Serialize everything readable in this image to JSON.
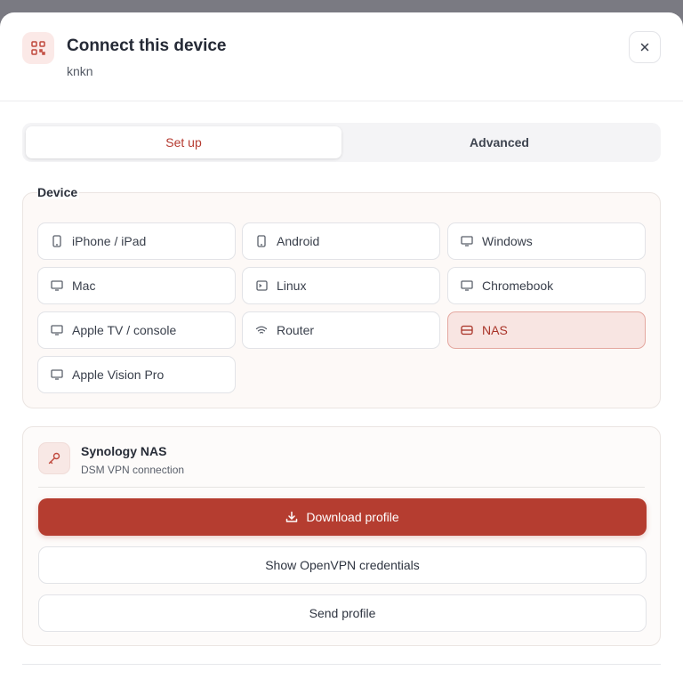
{
  "dialog": {
    "title": "Connect this device",
    "subtitle": "knkn",
    "header_icon": "qr-code-icon",
    "close_icon": "close-icon"
  },
  "tabs": [
    {
      "label": "Set up",
      "active": true
    },
    {
      "label": "Advanced",
      "active": false
    }
  ],
  "device": {
    "legend": "Device",
    "options": [
      {
        "label": "iPhone / iPad",
        "icon": "phone-icon",
        "selected": false
      },
      {
        "label": "Android",
        "icon": "phone-icon",
        "selected": false
      },
      {
        "label": "Windows",
        "icon": "monitor-icon",
        "selected": false
      },
      {
        "label": "Mac",
        "icon": "monitor-icon",
        "selected": false
      },
      {
        "label": "Linux",
        "icon": "terminal-icon",
        "selected": false
      },
      {
        "label": "Chromebook",
        "icon": "monitor-icon",
        "selected": false
      },
      {
        "label": "Apple TV / console",
        "icon": "monitor-icon",
        "selected": false
      },
      {
        "label": "Router",
        "icon": "wifi-icon",
        "selected": false
      },
      {
        "label": "NAS",
        "icon": "storage-icon",
        "selected": true
      },
      {
        "label": "Apple Vision Pro",
        "icon": "monitor-icon",
        "selected": false
      }
    ]
  },
  "result": {
    "title": "Synology NAS",
    "subtitle": "DSM VPN connection",
    "icon": "key-icon",
    "download_label": "Download profile",
    "download_icon": "download-icon",
    "credentials_label": "Show OpenVPN credentials",
    "send_label": "Send profile"
  },
  "colors": {
    "accent": "#b53d30",
    "selected_bg": "#f8e5e2",
    "backdrop": "#7a7a82"
  }
}
